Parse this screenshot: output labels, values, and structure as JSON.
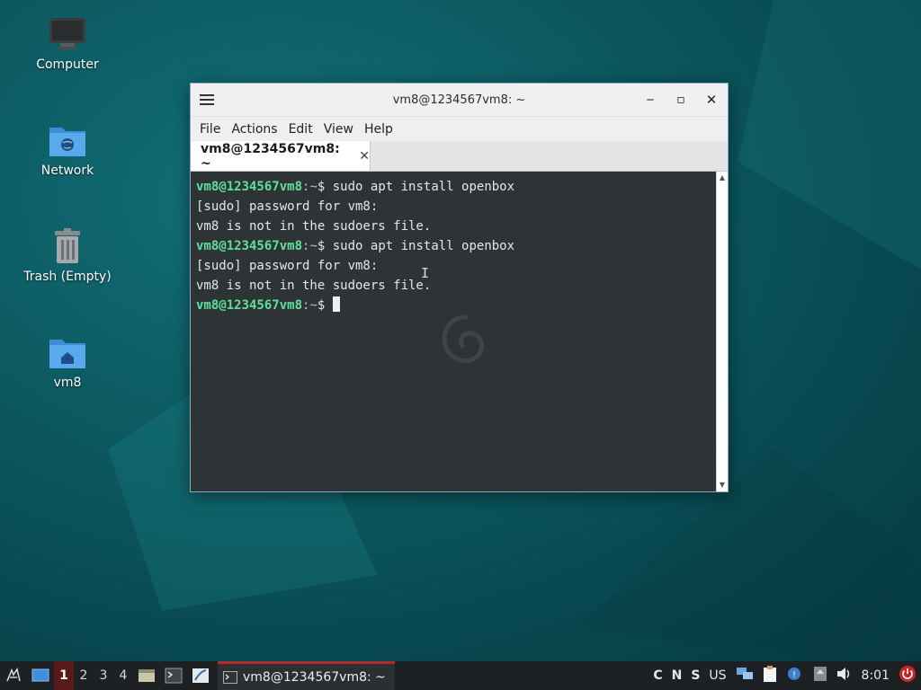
{
  "desktop": {
    "icons": [
      {
        "label": "Computer",
        "icon": "computer-icon"
      },
      {
        "label": "Network",
        "icon": "network-folder-icon"
      },
      {
        "label": "Trash (Empty)",
        "icon": "trash-icon"
      },
      {
        "label": "vm8",
        "icon": "home-folder-icon"
      }
    ]
  },
  "window": {
    "title": "vm8@1234567vm8: ~",
    "controls": {
      "minimize": "‒",
      "maximize": "▫",
      "close": "✕"
    },
    "menu": [
      "File",
      "Actions",
      "Edit",
      "View",
      "Help"
    ],
    "tab": {
      "label": "vm8@1234567vm8: ~",
      "close": "✕"
    },
    "terminal": {
      "prompt_user": "vm8@1234567vm8",
      "prompt_path": ":~",
      "prompt_symbol": "$",
      "lines": [
        {
          "type": "prompt",
          "command": " sudo apt install openbox"
        },
        {
          "type": "output",
          "text": "[sudo] password for vm8:"
        },
        {
          "type": "output",
          "text": "vm8 is not in the sudoers file."
        },
        {
          "type": "prompt",
          "command": " sudo apt install openbox"
        },
        {
          "type": "output",
          "text": "[sudo] password for vm8:"
        },
        {
          "type": "output",
          "text": "vm8 is not in the sudoers file."
        },
        {
          "type": "prompt",
          "command": " "
        }
      ]
    }
  },
  "taskbar": {
    "workspaces": [
      "1",
      "2",
      "3",
      "4"
    ],
    "active_workspace": "1",
    "task_label": "vm8@1234567vm8: ~",
    "tray": {
      "indicators": [
        "C",
        "N",
        "S"
      ],
      "keyboard_layout": "US",
      "clock": "8:01"
    }
  },
  "colors": {
    "prompt": "#5fe09a",
    "terminal_bg": "#2e3436",
    "taskbar_bg": "#1e2124",
    "active_accent": "#b52a2a"
  }
}
